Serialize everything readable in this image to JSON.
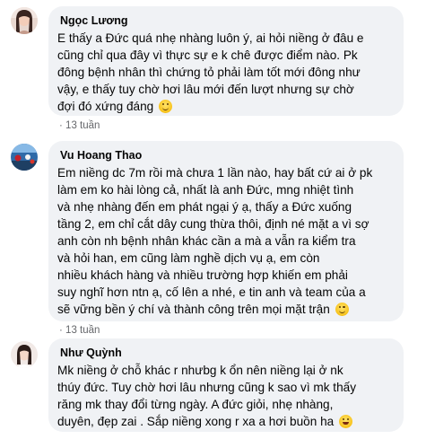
{
  "comments": [
    {
      "author": "Ngọc Lương",
      "text": "E thấy a Đức quá nhẹ nhàng luôn ý, ai hỏi niềng ở đâu e\ncũng chỉ qua đây vì thực sự e k chê được điểm nào. Pk\nđông bệnh nhân thì chứng tỏ phải làm tốt mới đông như\nvậy, e thấy tuy chờ hơi lâu mới đến lượt nhưng sự chờ\nđợi đó xứng đáng",
      "emoji": "smile-emoji",
      "dot": "·",
      "time": "13 tuần"
    },
    {
      "author": "Vu Hoang Thao",
      "text": "Em niềng dc 7m rồi mà chưa 1 lần nào, hay bất cứ ai ở pk\nlàm em ko hài lòng cả, nhất là anh Đức, mng nhiệt tình\nvà nhẹ nhàng đến em phát ngại ý ạ, thấy a Đức xuống\ntầng 2, em chỉ cắt dây cung thừa thôi, định né mặt a vì sợ\nanh còn nh bệnh nhân khác cần a mà a vẫn ra kiểm tra\nvà hỏi han, em cũng làm nghề dịch vụ ạ, em còn\nnhiều khách hàng và nhiều trường hợp khiến em phải\nsuy nghĩ hơn ntn ạ, cố lên a nhé, e tin anh và team của a\nsẽ vững bền ý chí và thành công trên mọi mặt trận",
      "emoji": "smile-emoji",
      "dot": "·",
      "time": "13 tuần"
    },
    {
      "author": "Như Quỳnh",
      "text": "Mk niềng ở chỗ khác r nhưbg k ổn nên niềng lại ở nk\nthúy đức. Tuy chờ hơi lâu nhưng cũng k sao vì mk thấy\nrăng mk thay đổi từng ngày. A đức giỏi, nhẹ nhàng,\nduyên, đẹp zai . Sắp niềng xong r xa a hơi buồn ha",
      "emoji": "laugh-emoji"
    }
  ]
}
